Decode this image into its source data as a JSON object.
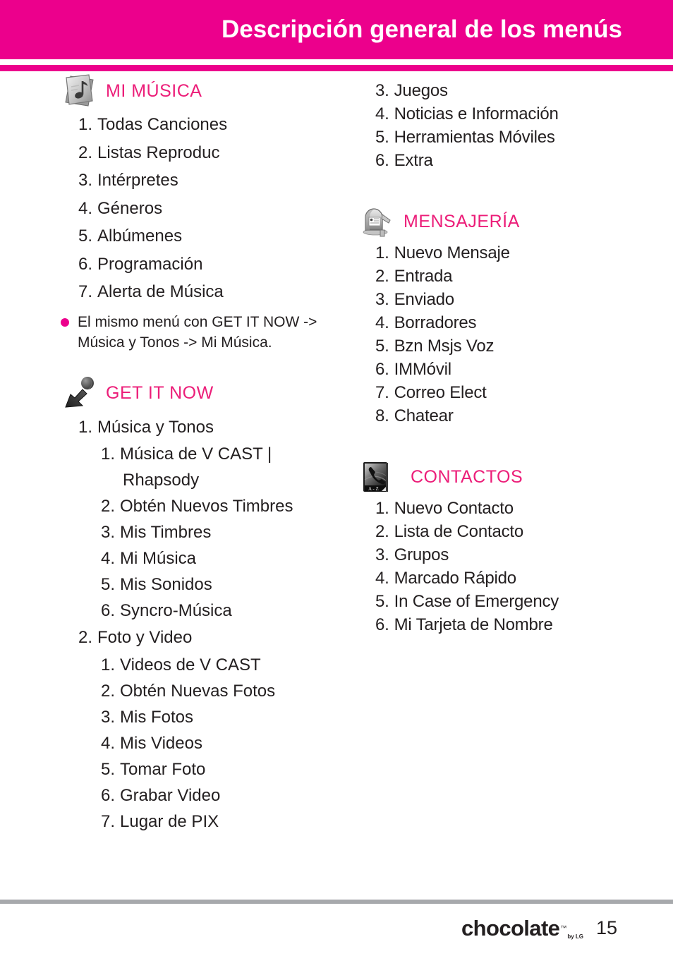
{
  "header": {
    "title": "Descripción general de los menús",
    "banner_color": "#ec008c"
  },
  "footer": {
    "logo_word": "chocolate",
    "logo_tm": "™",
    "logo_by": "by LG",
    "page_number": "15",
    "rule_color": "#a7a9ac"
  },
  "heading_color": "#ec1e79",
  "left_column": {
    "sections": [
      {
        "icon": "music-note-card-icon",
        "title": "MI MÚSICA",
        "items": [
          {
            "num": "1.",
            "label": "Todas Canciones"
          },
          {
            "num": "2.",
            "label": "Listas Reproduc"
          },
          {
            "num": "3.",
            "label": "Intérpretes"
          },
          {
            "num": "4.",
            "label": "Géneros"
          },
          {
            "num": "5.",
            "label": "Albúmenes"
          },
          {
            "num": "6.",
            "label": "Programación"
          },
          {
            "num": "7.",
            "label": "Alerta de Música"
          }
        ],
        "note": "El mismo menú con GET IT NOW -> Música y Tonos -> Mi Música."
      },
      {
        "icon": "arrow-ball-icon",
        "title": "GET IT NOW",
        "items": [
          {
            "num": "1.",
            "label": "Música y Tonos"
          },
          {
            "num": "1.",
            "label": "Música de V CAST |",
            "level": 2
          },
          {
            "num": "",
            "label": "Rhapsody",
            "level": 2,
            "continuation": true
          },
          {
            "num": "2.",
            "label": "Obtén Nuevos Timbres",
            "level": 2
          },
          {
            "num": "3.",
            "label": "Mis Timbres",
            "level": 2
          },
          {
            "num": "4.",
            "label": "Mi Música",
            "level": 2
          },
          {
            "num": "5.",
            "label": "Mis Sonidos",
            "level": 2
          },
          {
            "num": "6.",
            "label": "Syncro-Música",
            "level": 2
          },
          {
            "num": "2.",
            "label": "Foto y Video"
          },
          {
            "num": "1.",
            "label": "Videos de V CAST",
            "level": 2
          },
          {
            "num": "2.",
            "label": "Obtén Nuevas Fotos",
            "level": 2
          },
          {
            "num": "3.",
            "label": "Mis Fotos",
            "level": 2
          },
          {
            "num": "4.",
            "label": "Mis Videos",
            "level": 2
          },
          {
            "num": "5.",
            "label": "Tomar Foto",
            "level": 2
          },
          {
            "num": "6.",
            "label": "Grabar Video",
            "level": 2
          },
          {
            "num": "7.",
            "label": "Lugar de PIX",
            "level": 2
          }
        ]
      }
    ]
  },
  "right_column": {
    "continued_items": [
      {
        "num": "3.",
        "label": "Juegos"
      },
      {
        "num": "4.",
        "label": "Noticias e Información"
      },
      {
        "num": "5.",
        "label": "Herramientas Móviles"
      },
      {
        "num": "6.",
        "label": "Extra"
      }
    ],
    "sections": [
      {
        "icon": "mailbox-icon",
        "title": "MENSAJERÍA",
        "items": [
          {
            "num": "1.",
            "label": "Nuevo Mensaje"
          },
          {
            "num": "2.",
            "label": "Entrada"
          },
          {
            "num": "3.",
            "label": "Enviado"
          },
          {
            "num": "4.",
            "label": "Borradores"
          },
          {
            "num": "5.",
            "label": "Bzn Msjs Voz"
          },
          {
            "num": "6.",
            "label": "IMMóvil"
          },
          {
            "num": "7.",
            "label": "Correo Elect"
          },
          {
            "num": "8.",
            "label": "Chatear"
          }
        ]
      },
      {
        "icon": "address-book-phone-icon",
        "title": "CONTACTOS",
        "icon_label": "A - Z",
        "items": [
          {
            "num": "1.",
            "label": "Nuevo Contacto"
          },
          {
            "num": "2.",
            "label": "Lista de Contacto"
          },
          {
            "num": "3.",
            "label": "Grupos"
          },
          {
            "num": "4.",
            "label": "Marcado Rápido"
          },
          {
            "num": "5.",
            "label": "In Case of Emergency"
          },
          {
            "num": "6.",
            "label": "Mi Tarjeta de Nombre"
          }
        ]
      }
    ]
  }
}
